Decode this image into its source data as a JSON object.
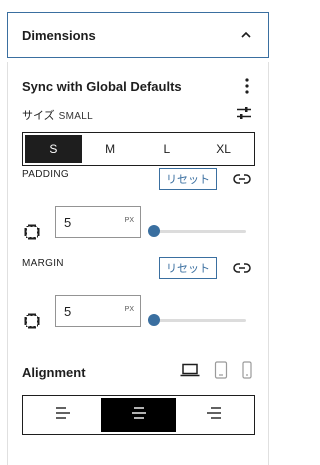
{
  "panel": {
    "title": "Dimensions",
    "expanded": true
  },
  "sync": {
    "title": "Sync with Global Defaults"
  },
  "size": {
    "label": "サイズ",
    "value": "SMALL",
    "options": [
      "S",
      "M",
      "L",
      "XL"
    ],
    "selected": "S"
  },
  "padding": {
    "label": "PADDING",
    "reset_label": "リセット",
    "value": "5",
    "unit": "PX",
    "slider_fraction": 0.0
  },
  "margin": {
    "label": "MARGIN",
    "reset_label": "リセット",
    "value": "5",
    "unit": "PX",
    "slider_fraction": 0.0
  },
  "alignment": {
    "title": "Alignment",
    "devices": [
      "desktop-icon",
      "tablet-icon",
      "mobile-icon"
    ],
    "options": [
      "align-left-icon",
      "align-center-icon",
      "align-right-icon"
    ],
    "selected": "align-center-icon"
  },
  "colors": {
    "accent": "#3a6fa0",
    "text": "#1e1e1e",
    "active_bg": "#1e1e1e"
  }
}
